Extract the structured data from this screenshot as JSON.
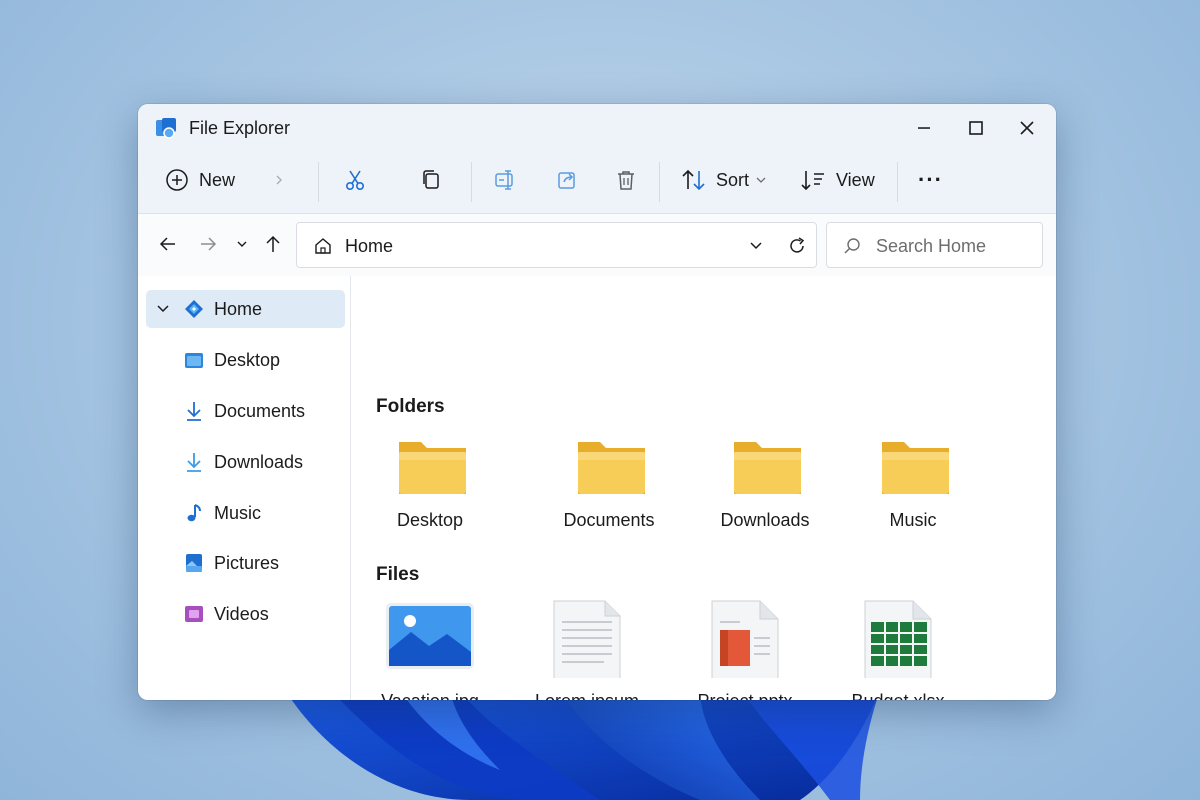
{
  "window": {
    "title": "File Explorer"
  },
  "toolbar": {
    "new_label": "New",
    "sort_label": "Sort",
    "view_label": "View",
    "more_label": "···"
  },
  "address": {
    "path": "Home"
  },
  "search": {
    "placeholder": "Search Home"
  },
  "sidebar": {
    "items": [
      {
        "label": "Home",
        "icon": "home-icon",
        "active": true
      },
      {
        "label": "Desktop",
        "icon": "desktop-icon"
      },
      {
        "label": "Documents",
        "icon": "download-arrow-icon"
      },
      {
        "label": "Downloads",
        "icon": "download-arrow-icon"
      },
      {
        "label": "Music",
        "icon": "music-note-icon"
      },
      {
        "label": "Pictures",
        "icon": "pictures-icon"
      },
      {
        "label": "Videos",
        "icon": "videos-icon"
      }
    ]
  },
  "main": {
    "folders_heading": "Folders",
    "files_heading": "Files",
    "folders": [
      {
        "label": "Desktop",
        "icon": "folder-icon"
      },
      {
        "label": "Documents",
        "icon": "folder-icon"
      },
      {
        "label": "Downloads",
        "icon": "folder-icon"
      },
      {
        "label": "Music",
        "icon": "folder-icon"
      }
    ],
    "files": [
      {
        "label": "Vacation.jpg",
        "icon": "image-file-icon"
      },
      {
        "label": "Lorem ipsum",
        "icon": "text-document-icon"
      },
      {
        "label": "Project.pptx",
        "icon": "presentation-file-icon"
      },
      {
        "label": "Budget.xlsx",
        "icon": "spreadsheet-file-icon"
      }
    ]
  },
  "colors": {
    "accent": "#0a64c8",
    "folder": "#f5c94a",
    "sidebar_active": "#dfeaf7",
    "wallpaper_bloom": "#0b3fc6"
  }
}
